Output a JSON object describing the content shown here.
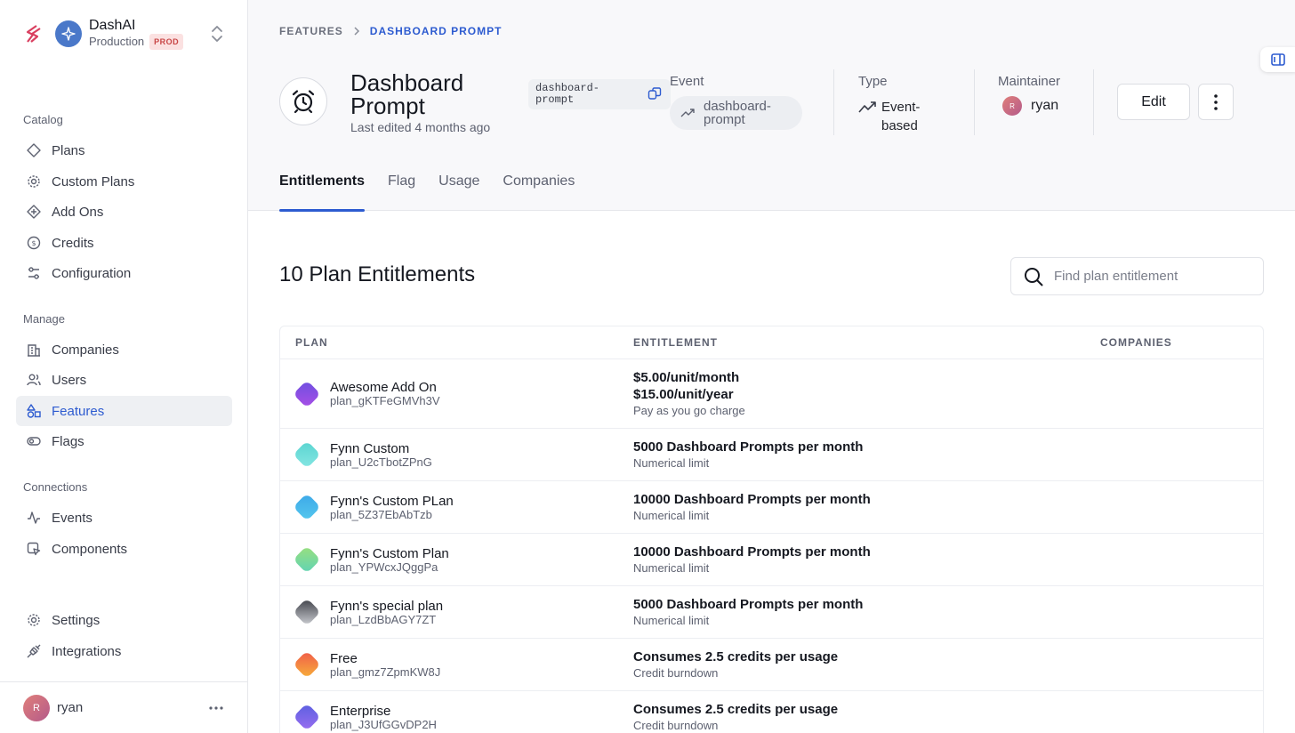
{
  "workspace": {
    "name": "DashAI",
    "env": "Production",
    "badge": "PROD"
  },
  "sidebar": {
    "sections": [
      {
        "label": "Catalog",
        "items": [
          {
            "label": "Plans",
            "icon": "tag-icon"
          },
          {
            "label": "Custom Plans",
            "icon": "gear-icon"
          },
          {
            "label": "Add Ons",
            "icon": "diamond-plus-icon"
          },
          {
            "label": "Credits",
            "icon": "coin-icon"
          },
          {
            "label": "Configuration",
            "icon": "sliders-icon"
          }
        ]
      },
      {
        "label": "Manage",
        "items": [
          {
            "label": "Companies",
            "icon": "building-icon"
          },
          {
            "label": "Users",
            "icon": "users-icon"
          },
          {
            "label": "Features",
            "icon": "shapes-icon",
            "active": true
          },
          {
            "label": "Flags",
            "icon": "toggle-icon"
          }
        ]
      },
      {
        "label": "Connections",
        "items": [
          {
            "label": "Events",
            "icon": "activity-icon"
          },
          {
            "label": "Components",
            "icon": "component-icon"
          }
        ]
      }
    ],
    "bottom": [
      {
        "label": "Settings",
        "icon": "gear-icon"
      },
      {
        "label": "Integrations",
        "icon": "plug-icon"
      }
    ],
    "user": {
      "name": "ryan",
      "initial": "R"
    }
  },
  "breadcrumb": {
    "parent": "FEATURES",
    "current": "DASHBOARD PROMPT"
  },
  "feature": {
    "title": "Dashboard Prompt",
    "edited": "Last edited 4 months ago",
    "key": "dashboard-prompt",
    "event_label": "Event",
    "event_value": "dashboard-prompt",
    "type_label": "Type",
    "type_value": "Event-based",
    "maintainer_label": "Maintainer",
    "maintainer": "ryan",
    "maintainer_initial": "R",
    "edit_label": "Edit"
  },
  "tabs": [
    {
      "label": "Entitlements",
      "active": true
    },
    {
      "label": "Flag"
    },
    {
      "label": "Usage"
    },
    {
      "label": "Companies"
    }
  ],
  "content": {
    "title": "10 Plan Entitlements",
    "search_placeholder": "Find plan entitlement",
    "columns": {
      "plan": "PLAN",
      "entitlement": "ENTITLEMENT",
      "companies": "COMPANIES"
    },
    "rows": [
      {
        "name": "Awesome Add On",
        "id": "plan_gKTFeGMVh3V",
        "lines": [
          "$5.00/unit/month",
          "$15.00/unit/year"
        ],
        "sub": "Pay as you go charge",
        "colors": [
          "#6d4fe0",
          "#a94fe6"
        ]
      },
      {
        "name": "Fynn Custom",
        "id": "plan_U2cTbotZPnG",
        "lines": [
          "5000 Dashboard Prompts per month"
        ],
        "sub": "Numerical limit",
        "colors": [
          "#59d4d0",
          "#86e6e3"
        ]
      },
      {
        "name": "Fynn's Custom PLan",
        "id": "plan_5Z37EbAbTzb",
        "lines": [
          "10000 Dashboard Prompts per month"
        ],
        "sub": "Numerical limit",
        "colors": [
          "#3ca7e8",
          "#55c8ee"
        ]
      },
      {
        "name": "Fynn's Custom Plan",
        "id": "plan_YPWcxJQggPa",
        "lines": [
          "10000 Dashboard Prompts per month"
        ],
        "sub": "Numerical limit",
        "colors": [
          "#9be07c",
          "#5fd3b6"
        ]
      },
      {
        "name": "Fynn's special plan",
        "id": "plan_LzdBbAGY7ZT",
        "lines": [
          "5000 Dashboard Prompts per month"
        ],
        "sub": "Numerical limit",
        "colors": [
          "#3b3d44",
          "#cfd1d6"
        ]
      },
      {
        "name": "Free",
        "id": "plan_gmz7ZpmKW8J",
        "lines": [
          "Consumes 2.5 credits per usage"
        ],
        "sub": "Credit burndown",
        "colors": [
          "#f05a4a",
          "#f7b13a"
        ]
      },
      {
        "name": "Enterprise",
        "id": "plan_J3UfGGvDP2H",
        "lines": [
          "Consumes 2.5 credits per usage"
        ],
        "sub": "Credit burndown",
        "colors": [
          "#5a5fe0",
          "#9a6ef0"
        ]
      }
    ]
  }
}
